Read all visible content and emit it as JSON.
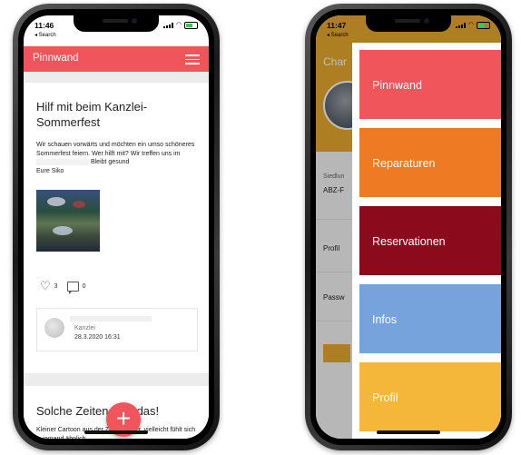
{
  "left_phone": {
    "status": {
      "time": "11:46",
      "back": "◂ Search"
    },
    "appbar": {
      "title": "Pinnwand"
    },
    "post1": {
      "title": "Hilf mit beim Kanzlei-Sommerfest",
      "body_a": "Wir schauen vorwärts und möchten ein umso schöneres Sommerfest feiern. Wer hilft mit? Wir treffen uns im",
      "body_b": "Bleibt gesund",
      "body_c": "Eure Siko",
      "likes": "3",
      "comments": "0",
      "author_org": "Kanzlei",
      "date": "28.3.2020 16:31"
    },
    "post2": {
      "title": "Solche Zeiten sind das!",
      "body": "Kleiner Cartoon aus der Zeitung oder, vielleicht fühlt sich ja jemand ähnlich..."
    },
    "fab": "+"
  },
  "right_phone": {
    "status": {
      "time": "11:47",
      "back": "◂ Search"
    },
    "profile": {
      "name": "Char",
      "siedlung_label": "Siedlun",
      "siedlung_value": "ABZ-F",
      "profil_link": "Profil",
      "passwort_link": "Passw"
    },
    "menu": [
      {
        "label": "Pinnwand",
        "color": "#f0555b"
      },
      {
        "label": "Reparaturen",
        "color": "#ee7a23"
      },
      {
        "label": "Reservationen",
        "color": "#8b0b1c"
      },
      {
        "label": "Infos",
        "color": "#77a3dc"
      },
      {
        "label": "Profil",
        "color": "#f5b73a"
      }
    ]
  }
}
